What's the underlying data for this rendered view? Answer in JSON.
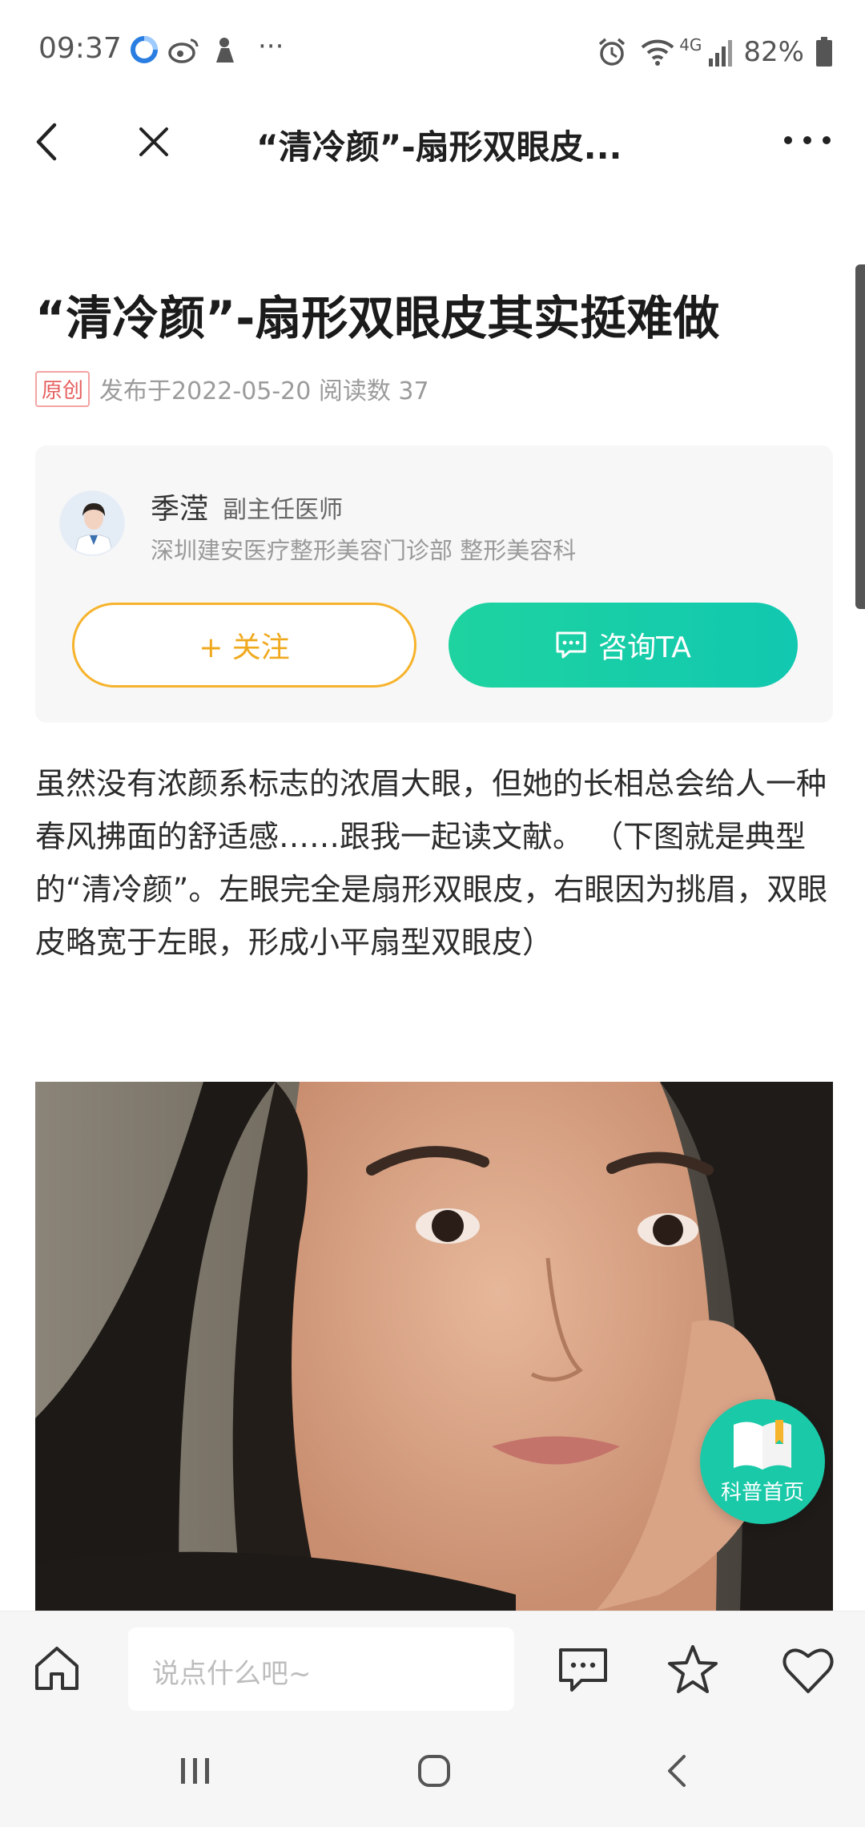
{
  "status_bar": {
    "time": "09:37",
    "more": "···",
    "network": "4G",
    "battery": "82%"
  },
  "nav": {
    "title": "“清冷颜”-扇形双眼皮..."
  },
  "article": {
    "title": "“清冷颜”-扇形双眼皮其实挺难做",
    "badge": "原创",
    "meta": "发布于2022-05-20 阅读数 37",
    "body": "虽然没有浓颜系标志的浓眉大眼，但她的长相总会给人一种春风拂面的舒适感……跟我一起读文献。 （下图就是典型的“清冷颜”。左眼完全是扇形双眼皮，右眼因为挑眉，双眼皮略宽于左眼，形成小平扇型双眼皮）"
  },
  "doctor": {
    "name": "季滢",
    "title": "副主任医师",
    "hospital": "深圳建安医疗整形美容门诊部 整形美容科",
    "follow_label": "+ 关注",
    "consult_label": "咨询TA"
  },
  "float_badge": {
    "label": "科普首页"
  },
  "bottom_bar": {
    "comment_placeholder": "说点什么吧~"
  },
  "colors": {
    "accent_green": "#19c9a8",
    "follow_orange": "#f6b32c",
    "badge_red": "#e65f5f"
  }
}
